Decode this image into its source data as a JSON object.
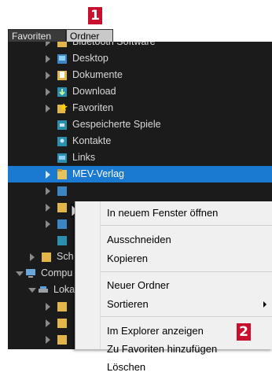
{
  "badges": {
    "one": "1",
    "two": "2"
  },
  "tabs": [
    {
      "label": "Favoriten",
      "active": false
    },
    {
      "label": "Ordner",
      "active": true
    }
  ],
  "tree": [
    {
      "label": "Bluetooth Software",
      "icon": "folder-icon"
    },
    {
      "label": "Desktop",
      "icon": "desktop-folder-icon"
    },
    {
      "label": "Dokumente",
      "icon": "documents-folder-icon"
    },
    {
      "label": "Download",
      "icon": "download-folder-icon"
    },
    {
      "label": "Favoriten",
      "icon": "favorites-star-icon"
    },
    {
      "label": "Gespeicherte Spiele",
      "icon": "saved-games-folder-icon"
    },
    {
      "label": "Kontakte",
      "icon": "contacts-folder-icon"
    },
    {
      "label": "Links",
      "icon": "links-folder-icon"
    },
    {
      "label": "MEV-Verlag",
      "icon": "folder-icon",
      "selected": true
    },
    {
      "label": "",
      "icon": "folder-icon"
    },
    {
      "label": "",
      "icon": "folder-icon"
    },
    {
      "label": "",
      "icon": "folder-icon"
    },
    {
      "label": "",
      "icon": "folder-icon"
    },
    {
      "label": "Sch",
      "icon": "folder-icon"
    },
    {
      "label": "Compu",
      "icon": "computer-icon"
    },
    {
      "label": "Loka",
      "icon": "drive-icon"
    },
    {
      "label": "",
      "icon": "folder-icon"
    },
    {
      "label": "",
      "icon": "folder-icon"
    },
    {
      "label": "",
      "icon": "folder-icon"
    }
  ],
  "context_menu": {
    "items": [
      {
        "label": "In neuem Fenster öffnen"
      },
      {
        "label": "Ausschneiden"
      },
      {
        "label": "Kopieren"
      },
      {
        "label": "Neuer Ordner"
      },
      {
        "label": "Sortieren",
        "submenu": true
      },
      {
        "label": "Im Explorer anzeigen"
      },
      {
        "label": "Zu Favoriten hinzufügen"
      },
      {
        "label": "Löschen"
      }
    ]
  },
  "colors": {
    "selection": "#1a79d1",
    "badge": "#c8102e",
    "panel": "#1b1b1b"
  }
}
